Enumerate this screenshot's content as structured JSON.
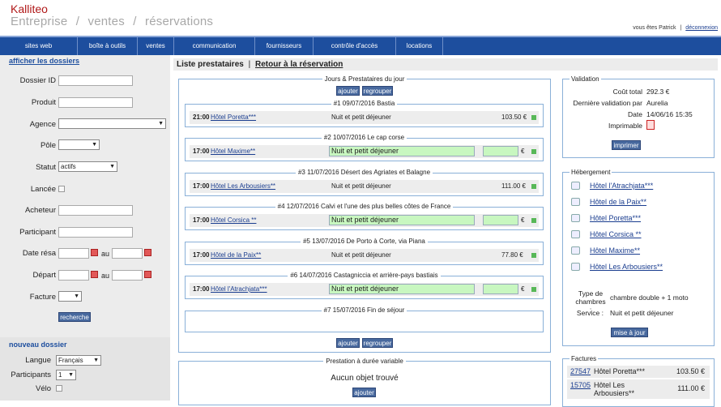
{
  "header": {
    "brand": "Kalliteo",
    "crumbs": [
      "Entreprise",
      "/",
      "ventes",
      "/",
      "réservations"
    ],
    "user_prefix": "vous êtes Patrick",
    "user_sep": "|",
    "logout": "déconnexion"
  },
  "nav": [
    "sites web",
    "boîte à outils",
    "ventes",
    "communication",
    "fournisseurs",
    "contrôle d'accès",
    "locations"
  ],
  "left": {
    "show_folders": "afficher les dossiers",
    "fields": {
      "dossier_id": "Dossier ID",
      "produit": "Produit",
      "agence": "Agence",
      "pole": "Pôle",
      "statut": "Statut",
      "statut_value": "actifs",
      "lancee": "Lancée",
      "acheteur": "Acheteur",
      "participant": "Participant",
      "date_resa": "Date résa",
      "au": "au",
      "depart": "Départ",
      "facture": "Facture"
    },
    "search_button": "recherche",
    "new_folder": "nouveau dossier",
    "new": {
      "langue": "Langue",
      "langue_value": "Français",
      "participants": "Participants",
      "participants_value": "1",
      "velo": "Vélo"
    }
  },
  "title": {
    "list": "Liste prestataires",
    "sep": "|",
    "back": "Retour à la réservation"
  },
  "days_panel": {
    "title": "Jours & Prestataires du jour",
    "add": "ajouter",
    "group": "regrouper",
    "days": [
      {
        "label": "#1 09/07/2016 Bastia",
        "time": "21:00",
        "hotel": "Hôtel Poretta***",
        "service": "Nuit et petit déjeuner",
        "price": "103.50 €"
      },
      {
        "label": "#2 10/07/2016 Le cap corse",
        "time": "17:00",
        "hotel": "Hôtel Maxime**",
        "service": "Nuit et petit déjeuner",
        "price": "",
        "currency": "€"
      },
      {
        "label": "#3 11/07/2016 Désert des Agriates et Balagne",
        "time": "17:00",
        "hotel": "Hôtel Les Arbousiers**",
        "service": "Nuit et petit déjeuner",
        "price": "111.00 €"
      },
      {
        "label": "#4 12/07/2016 Calvi et l'une des plus belles côtes de France",
        "time": "17:00",
        "hotel": "Hôtel Corsica **",
        "service": "Nuit et petit déjeuner",
        "price": "",
        "currency": "€"
      },
      {
        "label": "#5 13/07/2016 De Porto à Corte, via Piana",
        "time": "17:00",
        "hotel": "Hôtel de la Paix**",
        "service": "Nuit et petit déjeuner",
        "price": "77.80 €"
      },
      {
        "label": "#6 14/07/2016 Castagniccia et arrière-pays bastiais",
        "time": "17:00",
        "hotel": "Hôtel l'Atrachjata***",
        "service": "Nuit et petit déjeuner",
        "price": "",
        "currency": "€"
      },
      {
        "label": "#7 15/07/2016 Fin de séjour"
      }
    ]
  },
  "variable_panel": {
    "title": "Prestation à durée variable",
    "empty": "Aucun objet trouvé",
    "add": "ajouter"
  },
  "validation": {
    "title": "Validation",
    "rows": [
      [
        "Coût total",
        "292.3 €"
      ],
      [
        "Dernière validation par",
        "Aurelia"
      ],
      [
        "Date",
        "14/06/16 15:35"
      ],
      [
        "Imprimable",
        ""
      ]
    ],
    "print": "imprimer"
  },
  "hebergement": {
    "title": "Hébergement",
    "hotels": [
      "Hôtel l'Atrachjata***",
      "Hôtel de la Paix**",
      "Hôtel Poretta***",
      "Hôtel Corsica **",
      "Hôtel Maxime**",
      "Hôtel Les Arbousiers**"
    ],
    "room_label": "Type de chambres :",
    "room_value": "chambre double + 1 moto",
    "service_label": "Service :",
    "service_value": "Nuit et petit déjeuner",
    "update": "mise à jour"
  },
  "factures": {
    "title": "Factures",
    "rows": [
      {
        "id": "27547",
        "name": "Hôtel Poretta***",
        "amount": "103.50 €"
      },
      {
        "id": "15705",
        "name": "Hôtel Les Arbousiers**",
        "amount": "111.00 €"
      }
    ]
  }
}
